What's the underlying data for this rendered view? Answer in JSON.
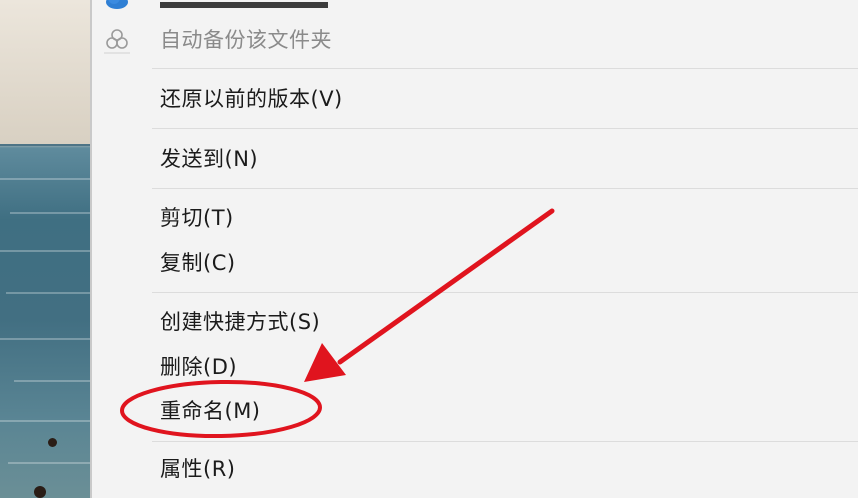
{
  "context_menu": {
    "items": [
      {
        "key": "move_to_onedrive",
        "label": "",
        "disabled": false,
        "icon": "onedrive-cloud-icon"
      },
      {
        "key": "auto_backup_folder",
        "label": "自动备份该文件夹",
        "disabled": true,
        "icon": "sync-clover-icon"
      },
      {
        "key": "restore_previous_versions",
        "label": "还原以前的版本(V)",
        "disabled": false
      },
      {
        "key": "send_to",
        "label": "发送到(N)",
        "disabled": false
      },
      {
        "key": "cut",
        "label": "剪切(T)",
        "disabled": false
      },
      {
        "key": "copy",
        "label": "复制(C)",
        "disabled": false
      },
      {
        "key": "create_shortcut",
        "label": "创建快捷方式(S)",
        "disabled": false
      },
      {
        "key": "delete",
        "label": "删除(D)",
        "disabled": false
      },
      {
        "key": "rename",
        "label": "重命名(M)",
        "disabled": false,
        "highlighted": true
      },
      {
        "key": "properties",
        "label": "属性(R)",
        "disabled": false
      }
    ]
  },
  "annotation": {
    "color": "#e0141e",
    "target": "rename",
    "shape": "circle-and-arrow"
  },
  "colors": {
    "menu_background": "#f3f3f3",
    "text": "#1b1b1b",
    "disabled_text": "#8a8a8a",
    "separator": "#dcdcdc",
    "annotation_red": "#e0141e"
  }
}
